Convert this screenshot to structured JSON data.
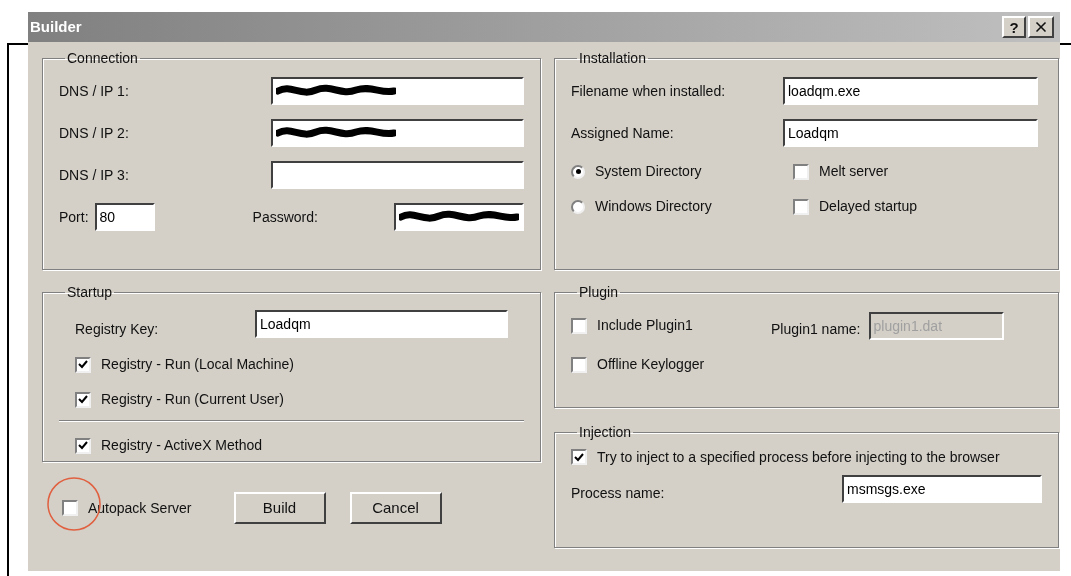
{
  "window": {
    "title": "Builder",
    "help": "?"
  },
  "connection": {
    "title": "Connection",
    "fields": [
      {
        "label": "DNS / IP 1:",
        "redacted": true
      },
      {
        "label": "DNS / IP 2:",
        "redacted": true
      },
      {
        "label": "DNS / IP 3:",
        "redacted": false
      }
    ],
    "port": {
      "label": "Port:",
      "value": "80"
    },
    "password": {
      "label": "Password:",
      "redacted": true
    }
  },
  "installation": {
    "title": "Installation",
    "fields": [
      {
        "label": "Filename when installed:",
        "value": "loadqm.exe"
      },
      {
        "label": "Assigned Name:",
        "value": "Loadqm"
      }
    ],
    "radios": [
      {
        "label": "System Directory",
        "selected": true
      },
      {
        "label": "Windows Directory",
        "selected": false
      }
    ],
    "checkboxes": [
      {
        "label": "Melt server",
        "checked": false
      },
      {
        "label": "Delayed startup",
        "checked": false
      }
    ]
  },
  "startup": {
    "title": "Startup",
    "registry_key": {
      "label": "Registry Key:",
      "value": "Loadqm"
    },
    "checkboxes": [
      {
        "label": "Registry - Run (Local Machine)",
        "checked": true
      },
      {
        "label": "Registry - Run (Current User)",
        "checked": true
      }
    ],
    "activex": {
      "label": "Registry - ActiveX Method",
      "checked": true
    }
  },
  "plugin": {
    "title": "Plugin",
    "checkboxes": [
      {
        "label": "Include Plugin1",
        "checked": false
      },
      {
        "label": "Offline Keylogger",
        "checked": false
      }
    ],
    "plugin_name": {
      "label": "Plugin1 name:",
      "value": "plugin1.dat",
      "disabled": true
    }
  },
  "injection": {
    "title": "Injection",
    "option": {
      "label": "Try to inject to a specified process before injecting to the browser",
      "checked": true
    },
    "process_name": {
      "label": "Process name:",
      "value": "msmsgs.exe"
    }
  },
  "footer": {
    "autopack": {
      "label": "Autopack Server",
      "checked": false
    },
    "buttons": [
      "Build",
      "Cancel"
    ]
  }
}
